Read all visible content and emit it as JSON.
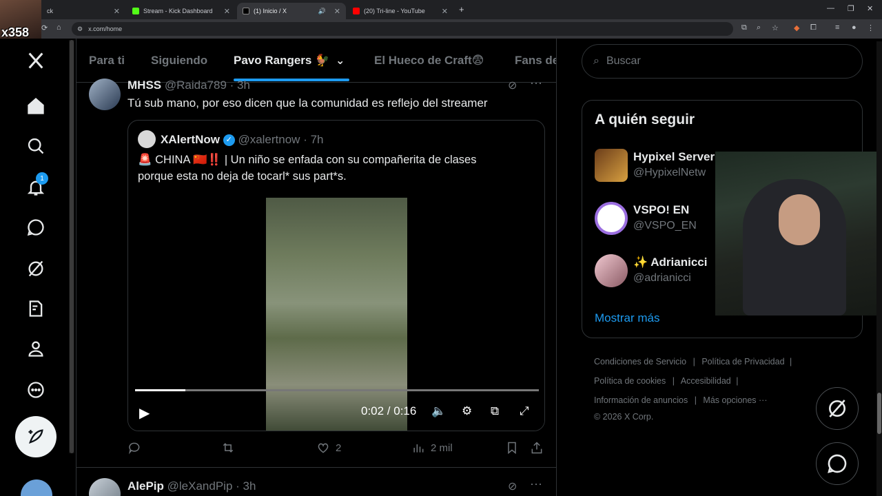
{
  "browser": {
    "tabs": [
      {
        "title": "ck",
        "active": false
      },
      {
        "title": "Stream - Kick Dashboard",
        "active": false
      },
      {
        "title": "(1) Inicio / X",
        "active": true
      },
      {
        "title": "(20) Tri-line - YouTube",
        "active": false
      }
    ],
    "url": "x.com/home"
  },
  "overlay": {
    "viewer_badge": "x358"
  },
  "sidebar": {
    "notification_count": "1"
  },
  "feed_tabs": [
    {
      "label": "Para ti",
      "active": false
    },
    {
      "label": "Siguiendo",
      "active": false
    },
    {
      "label": "Pavo Rangers 🐓",
      "active": true
    },
    {
      "label": "El Hueco de Craft😨",
      "active": false
    },
    {
      "label": "Fans de",
      "active": false
    }
  ],
  "tweet": {
    "name": "MHSS",
    "handle": "@Raida789",
    "time": "· 3h",
    "text": "Tú sub mano, por eso dicen que la comunidad es reflejo del streamer",
    "quote": {
      "name": "XAlertNow",
      "handle": "@xalertnow",
      "time": "· 7h",
      "text_line1": "🚨 CHINA 🇨🇳‼️ | Un niño se enfada con su compañerita de clases",
      "text_line2": "porque esta no deja de tocarl* sus part*s."
    },
    "video": {
      "time_display": "0:02 / 0:16",
      "progress": 0.125
    },
    "likes": "2",
    "views": "2 mil"
  },
  "next_tweet": {
    "name": "AlePip",
    "handle": "@leXandPip",
    "time": "· 3h"
  },
  "search": {
    "placeholder": "Buscar"
  },
  "who_to_follow": {
    "title": "A quién seguir",
    "items": [
      {
        "name": "Hypixel Server",
        "handle": "@HypixelNetw"
      },
      {
        "name": "VSPO! EN",
        "handle": "@VSPO_EN"
      },
      {
        "name": "✨ Adrianicci",
        "handle": "@adrianicci"
      }
    ],
    "show_more": "Mostrar más"
  },
  "footer": {
    "terms": "Condiciones de Servicio",
    "privacy": "Política de Privacidad",
    "cookies": "Política de cookies",
    "accessibility": "Accesibilidad",
    "ads": "Información de anuncios",
    "more": "Más opciones ···",
    "copyright": "© 2026 X Corp."
  },
  "colors": {
    "accent": "#1d9bf0",
    "background": "#000000",
    "border": "#2f3336",
    "muted": "#71767b"
  }
}
